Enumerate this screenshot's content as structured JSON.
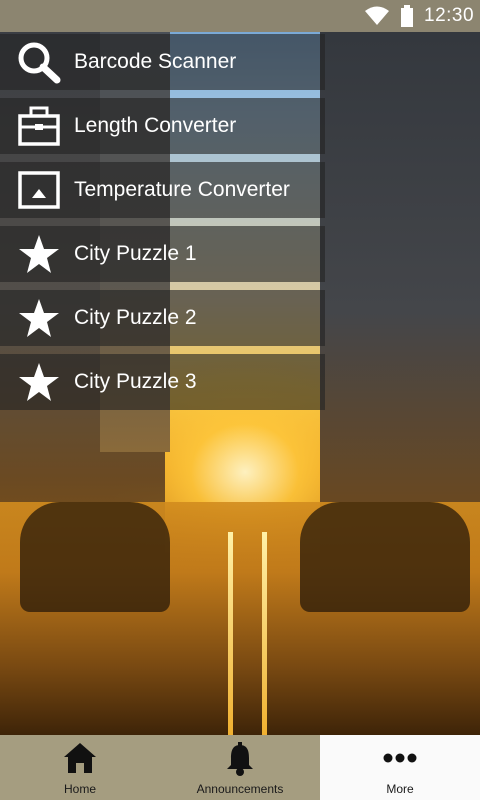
{
  "status_bar": {
    "time": "12:30"
  },
  "menu": {
    "items": [
      {
        "label": "Barcode Scanner",
        "icon": "search-icon"
      },
      {
        "label": "Length Converter",
        "icon": "briefcase-icon"
      },
      {
        "label": "Temperature Converter",
        "icon": "picture-frame-icon"
      },
      {
        "label": "City Puzzle 1",
        "icon": "star-icon"
      },
      {
        "label": "City Puzzle 2",
        "icon": "star-icon"
      },
      {
        "label": "City Puzzle 3",
        "icon": "star-icon"
      }
    ]
  },
  "tabs": [
    {
      "label": "Home",
      "icon": "home-icon",
      "active": false
    },
    {
      "label": "Announcements",
      "icon": "bell-icon",
      "active": false
    },
    {
      "label": "More",
      "icon": "more-dots-icon",
      "active": true
    }
  ],
  "colors": {
    "status_bar": "#8c8570",
    "tab_bar": "#a59d80",
    "tab_active": "#fafafa",
    "menu_item_bg": "rgba(35,35,35,0.62)"
  }
}
